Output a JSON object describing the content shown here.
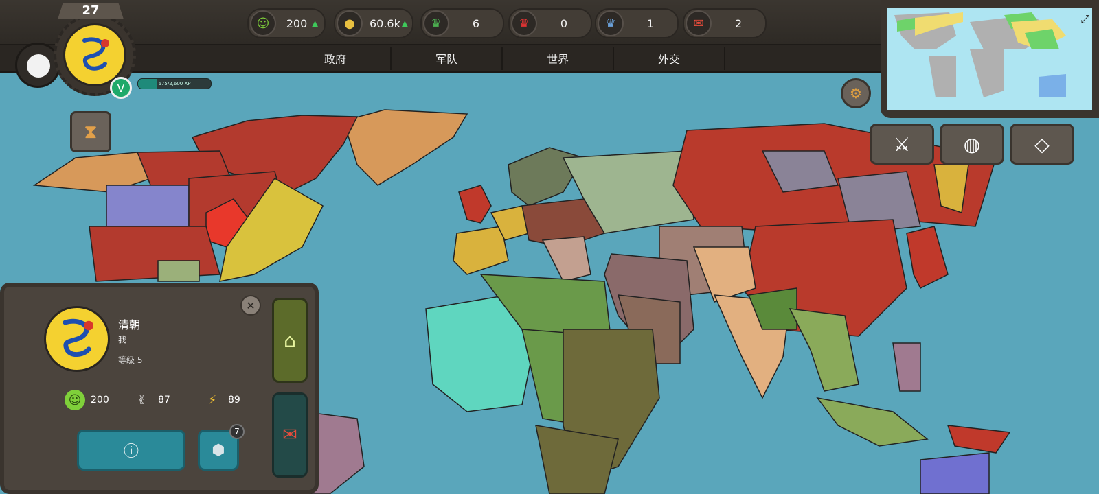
{
  "player": {
    "level": "27",
    "rank_badge": "V",
    "xp_text": "675/2,600 XP",
    "xp_progress": 0.26
  },
  "resources": [
    {
      "icon": "happiness-icon",
      "value": "200",
      "trend": "up"
    },
    {
      "icon": "gold-coins-icon",
      "value": "60.6k",
      "trend": "up"
    },
    {
      "icon": "green-crown-icon",
      "value": "6"
    },
    {
      "icon": "red-crown-icon",
      "value": "0"
    },
    {
      "icon": "blue-crown-icon",
      "value": "1"
    },
    {
      "icon": "letter-icon",
      "value": "2"
    }
  ],
  "tabs": [
    "政府",
    "军队",
    "世界",
    "外交"
  ],
  "panel": {
    "country_name": "清朝",
    "subtitle": "我",
    "level_label": "等级 5",
    "stats": [
      {
        "icon": "happiness-icon",
        "value": "200"
      },
      {
        "icon": "manpower-icon",
        "value": "87"
      },
      {
        "icon": "energy-icon",
        "value": "89"
      }
    ],
    "cube_count": "7"
  },
  "colors": {
    "ocean": "#5aa6bb",
    "qing_yellow": "#f4d130",
    "russia_red": "#b93a2c"
  }
}
